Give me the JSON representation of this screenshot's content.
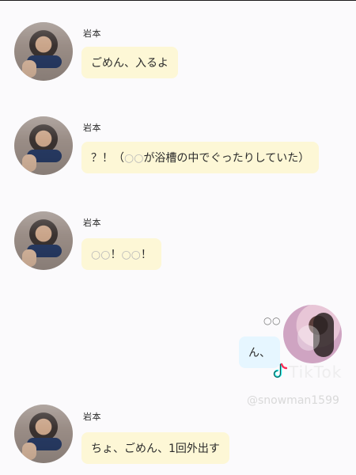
{
  "chat": {
    "messages": [
      {
        "side": "left",
        "name": "岩本",
        "text": "ごめん、入るよ"
      },
      {
        "side": "left",
        "name": "岩本",
        "text_prefix": "？！（",
        "text_muted": "○○",
        "text_suffix": "が浴槽の中でぐったりしていた）"
      },
      {
        "side": "left",
        "name": "岩本",
        "text_muted_1": "○○",
        "text_mid": "！",
        "text_muted_2": "○○",
        "text_suffix": "！"
      },
      {
        "side": "right",
        "name": "○○",
        "text": "ん、"
      },
      {
        "side": "left",
        "name": "岩本",
        "text": "ちょ、ごめん、1回外出す"
      }
    ]
  },
  "overlay": {
    "tiktok_label": "TikTok",
    "handle": "@snowman1599"
  },
  "colors": {
    "left_bubble": "#fdf7d6",
    "right_bubble": "#e6f6ff",
    "background": "#fbfafc"
  }
}
